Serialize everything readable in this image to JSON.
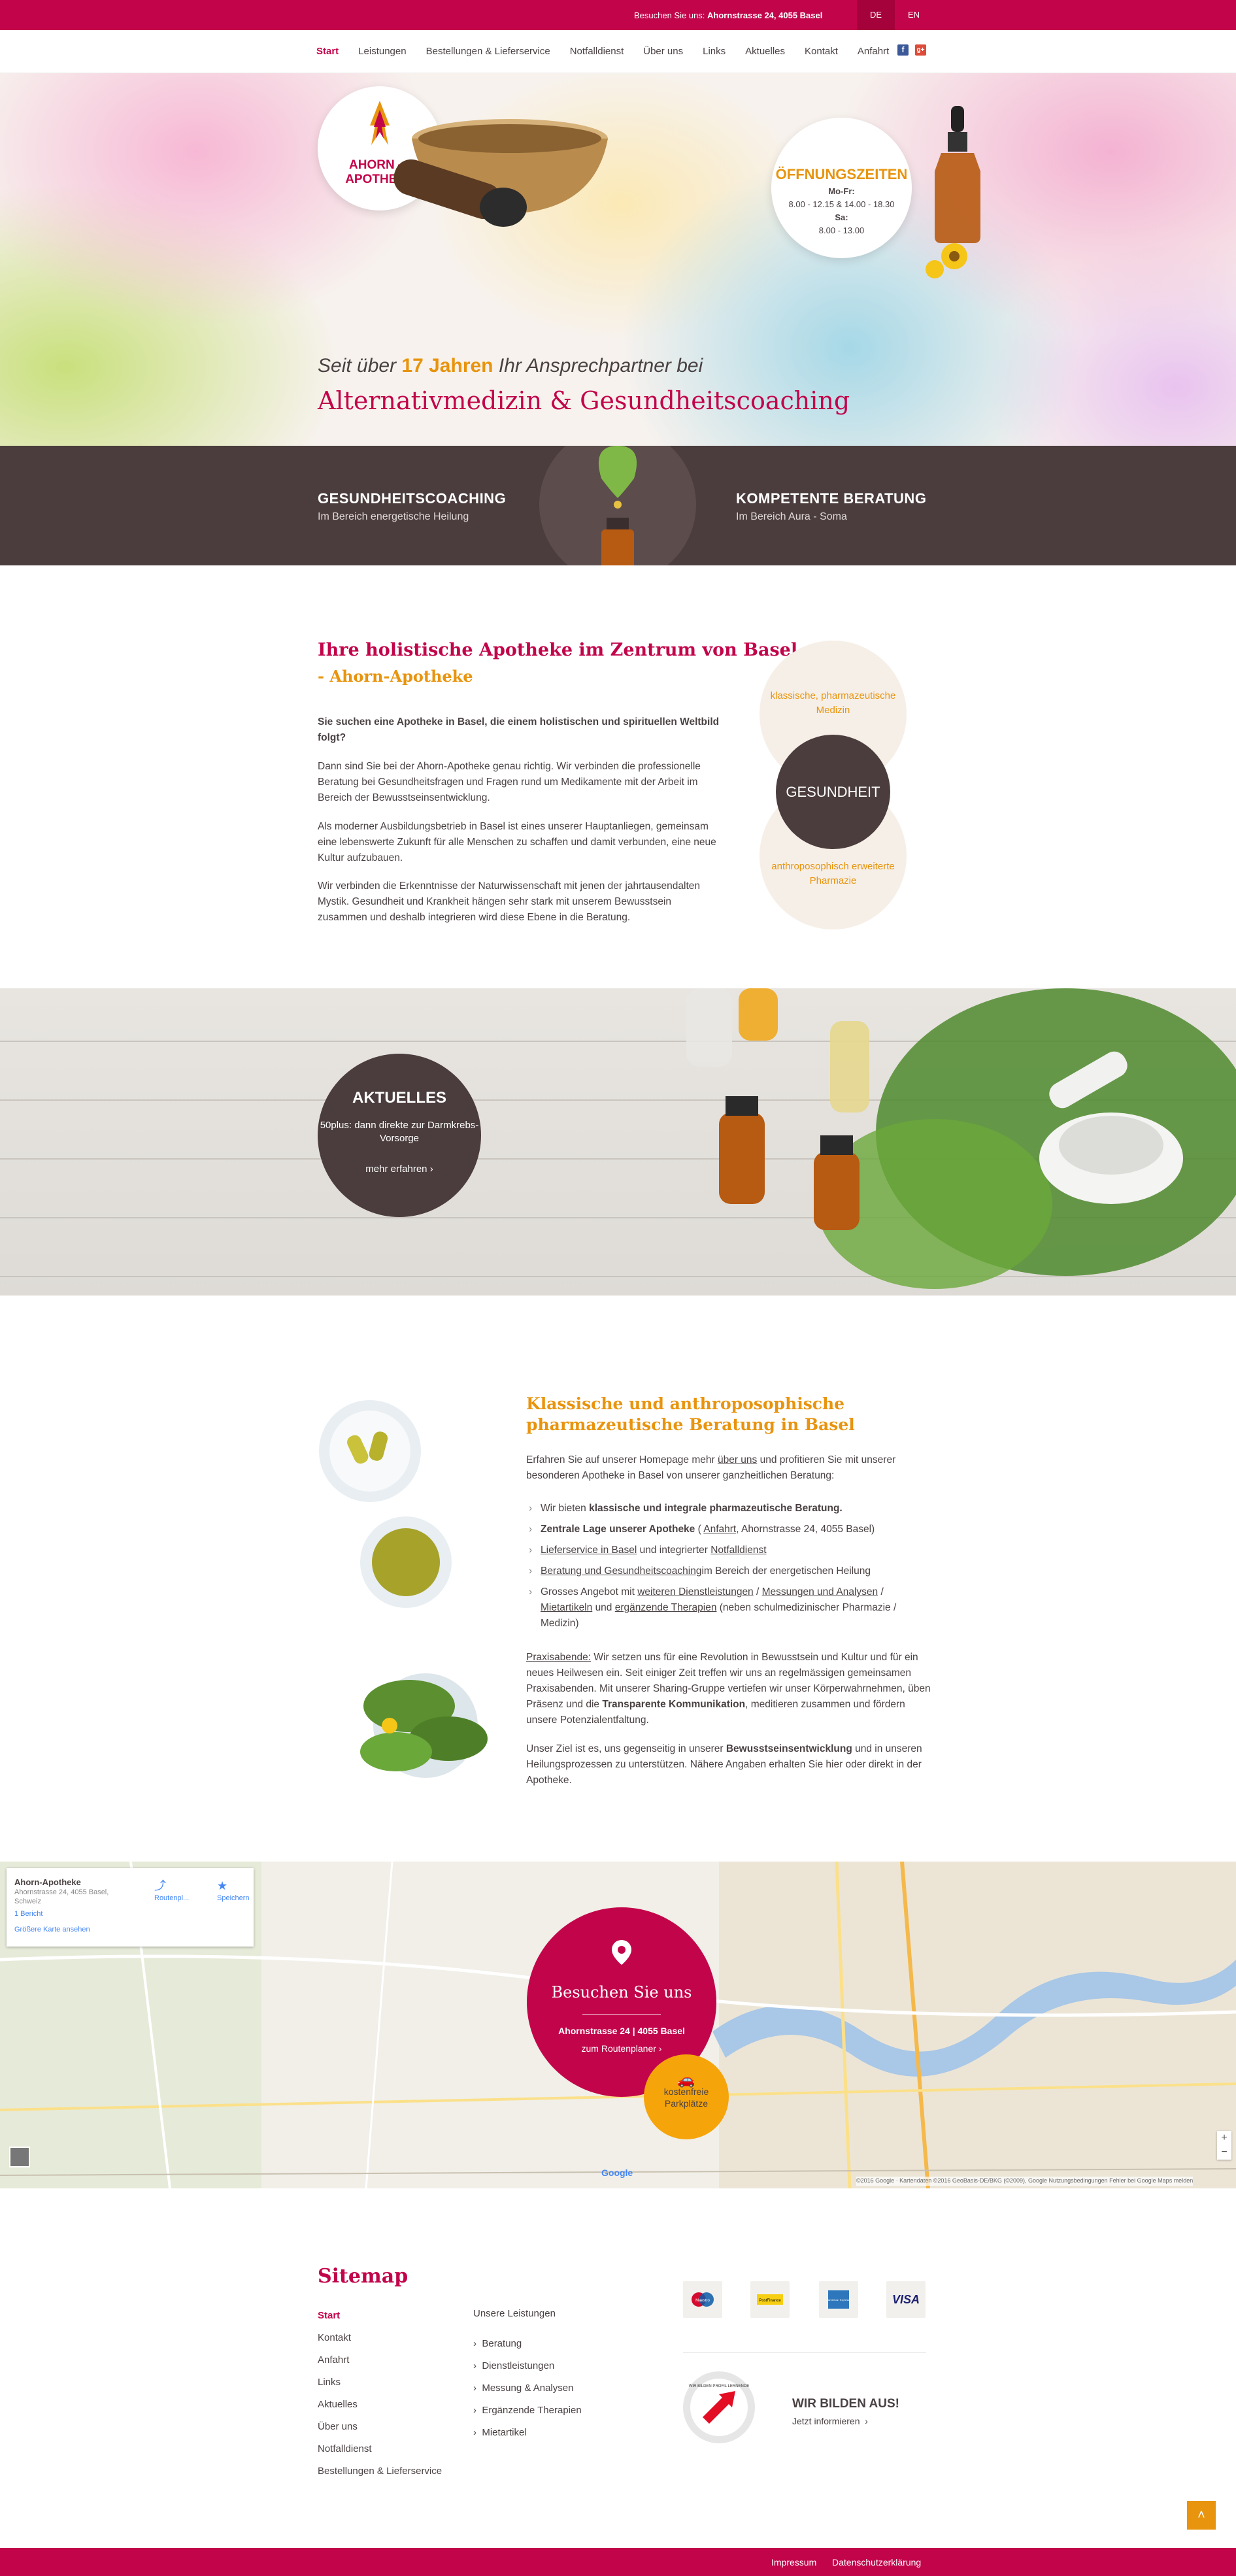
{
  "topbar": {
    "visit_label": "Besuchen Sie uns:",
    "address": "Ahornstrasse 24, 4055 Basel",
    "lang_de": "DE",
    "lang_en": "EN"
  },
  "nav": {
    "items": [
      "Start",
      "Leistungen",
      "Bestellungen & Lieferservice",
      "Notfalldienst",
      "Über uns",
      "Links",
      "Aktuelles",
      "Kontakt",
      "Anfahrt"
    ]
  },
  "logo": {
    "line1": "AHORN —",
    "line2": "APOTHEKE"
  },
  "opening": {
    "title": "ÖFFNUNGSZEITEN",
    "day1": "Mo-Fr:",
    "hours1": "8.00 - 12.15 & 14.00 - 18.30",
    "day2": "Sa:",
    "hours2": "8.00 - 13.00"
  },
  "hero": {
    "tag_pre": "Seit über",
    "tag_years": "17 Jahren",
    "tag_post": "Ihr Ansprechpartner bei",
    "headline": "Alternativmedizin & Gesundheitscoaching"
  },
  "band": {
    "left_title": "GESUNDHEITSCOACHING",
    "left_sub": "Im Bereich energetische Heilung",
    "right_title": "KOMPETENTE BERATUNG",
    "right_sub": "Im Bereich Aura - Soma"
  },
  "intro": {
    "title": "Ihre holistische Apotheke im Zentrum von Basel",
    "subtitle": "- Ahorn-Apotheke",
    "lead": "Sie suchen eine Apotheke in Basel, die einem holistischen und spirituellen Weltbild folgt?",
    "p1": "Dann sind Sie bei der Ahorn-Apotheke genau richtig. Wir verbinden die professionelle Beratung bei Gesundheitsfragen und Fragen rund um Medikamente mit der Arbeit im Bereich der Bewusstseinsentwicklung.",
    "p2": "Als moderner Ausbildungsbetrieb in Basel ist eines unserer Hauptanliegen, gemeinsam eine lebenswerte Zukunft für alle Menschen zu schaffen und damit verbunden, eine neue Kultur aufzubauen.",
    "p3": "Wir verbinden die Erkenntnisse der Naturwissenschaft mit jenen der jahrtausendalten Mystik. Gesundheit und Krankheit hängen sehr stark mit unserem Bewusstsein zusammen und deshalb integrieren wird diese Ebene in die Beratung."
  },
  "circles": {
    "top": "klassische, pharmazeutische Medizin",
    "center": "GESUNDHEIT",
    "bottom": "anthroposophisch erweiterte Pharmazie"
  },
  "aktuelles": {
    "title": "AKTUELLES",
    "text": "50plus: dann direkte zur Darmkrebs-Vorsorge",
    "more": "mehr erfahren"
  },
  "section2": {
    "title": "Klassische und anthroposophische pharmazeutische Beratung in Basel",
    "intro_pre": "Erfahren Sie auf unserer Homepage mehr",
    "intro_link": "über uns",
    "intro_post": "und profitieren Sie mit unserer besonderen Apotheke in Basel von unserer ganzheitlichen Beratung:",
    "b1_pre": "Wir bieten",
    "b1_bold": "klassische und integrale pharmazeutische Beratung.",
    "b2_bold": "Zentrale Lage unserer Apotheke",
    "b2_link": "Anfahrt",
    "b2_post": ", Ahornstrasse 24, 4055 Basel)",
    "b3_link": "Lieferservice in Basel",
    "b3_mid": "und integrierter",
    "b3_link2": "Notfalldienst",
    "b4_link": "Beratung und Gesundheitscoaching",
    "b4_post": "im Bereich der energetischen Heilung",
    "b5_pre": "Grosses Angebot mit",
    "b5_l1": "weiteren Dienstleistungen",
    "b5_l2": "Messungen und Analysen",
    "b5_l3": "Mietartikeln",
    "b5_mid": "und",
    "b5_l4": "ergänzende Therapien",
    "b5_post": "(neben schulmedizinischer Pharmazie / Medizin)",
    "p2_link": "Praxisabende:",
    "p2_a": "Wir setzen uns für eine Revolution in Bewusstsein und Kultur und für ein neues Heilwesen ein. Seit einiger Zeit treffen wir uns an regelmässigen gemeinsamen Praxisabenden. Mit unserer Sharing-Gruppe vertiefen wir unser Körperwahrnehmen, üben Präsenz und die",
    "p2_bold": "Transparente Kommunikation",
    "p2_b": ", meditieren zusammen und fördern unsere Potenzialentfaltung.",
    "p3_a": "Unser Ziel ist es, uns gegenseitig in unserer",
    "p3_bold": "Bewusstseinsentwicklung",
    "p3_b": "und in unseren Heilungsprozessen zu unterstützen. Nähere Angaben erhalten Sie hier oder direkt in der Apotheke."
  },
  "map": {
    "card_title": "Ahorn-Apotheke",
    "card_addr": "Ahornstrasse 24, 4055 Basel, Schweiz",
    "card_reviews": "1 Bericht",
    "card_link": "Größere Karte ansehen",
    "route": "Routenpl...",
    "save": "Speichern",
    "pin_title": "Besuchen Sie uns",
    "pin_addr": "Ahornstrasse 24 | 4055 Basel",
    "pin_route": "zum Routenplaner",
    "park_line1": "kostenfreie",
    "park_line2": "Parkplätze",
    "attribution": "©2016 Google · Kartendaten ©2016 GeoBasis-DE/BKG (©2009), Google   Nutzungsbedingungen   Fehler bei Google Maps melden",
    "google": "Google"
  },
  "footer": {
    "sitemap": "Sitemap",
    "col1": [
      "Start",
      "Kontakt",
      "Anfahrt",
      "Links",
      "Aktuelles",
      "Über uns",
      "Notfalldienst",
      "Bestellungen & Lieferservice"
    ],
    "col2_title": "Unsere Leistungen",
    "col2": [
      "Beratung",
      "Dienstleistungen",
      "Messung & Analysen",
      "Ergänzende Therapien",
      "Mietartikel"
    ],
    "payments": [
      "Maestro",
      "PostFinance",
      "American Express",
      "VISA"
    ],
    "ausbildung_title": "WIR BILDEN AUS!",
    "ausbildung_link": "Jetzt informieren",
    "badge": "WIR BILDEN PROFIL LERNENDE"
  },
  "bottom": {
    "impressum": "Impressum",
    "datenschutz": "Datenschutzerklärung"
  },
  "colors": {
    "brand": "#c2044a",
    "accent": "#e8940e",
    "dark": "#4b3d3d"
  }
}
